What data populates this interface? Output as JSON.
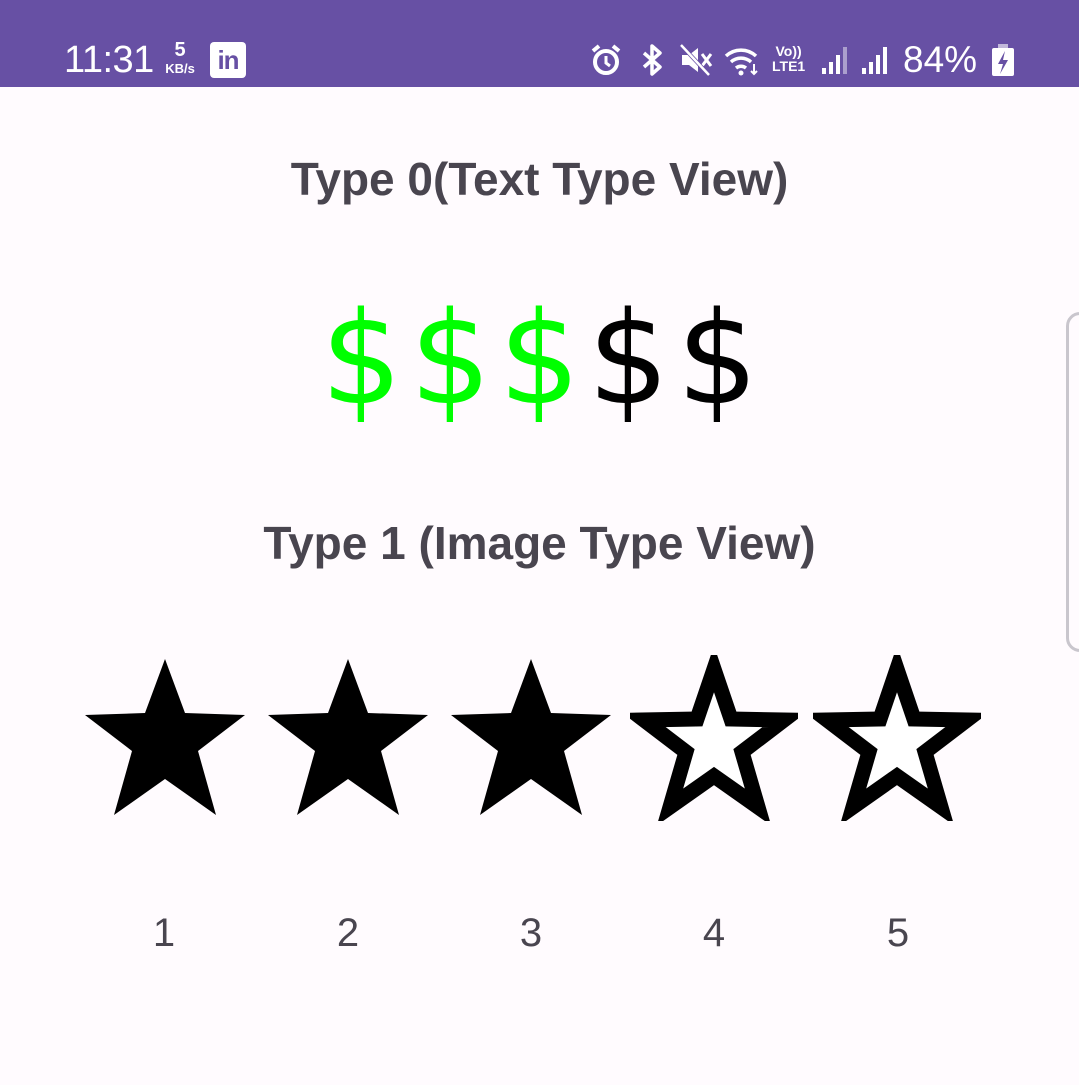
{
  "status_bar": {
    "time": "11:31",
    "net_speed_value": "5",
    "net_speed_unit": "KB/s",
    "linkedin_label": "in",
    "icons": [
      "alarm-icon",
      "bluetooth-icon",
      "mute-icon",
      "wifi-icon",
      "volte-icon",
      "signal-icon",
      "signal-icon",
      "battery-charging-icon"
    ],
    "lte_top": "Vo))",
    "lte_bottom": "LTE1",
    "battery_percent": "84%",
    "color": "#6750a4"
  },
  "type0": {
    "heading": "Type 0(Text Type View)",
    "symbol": "$",
    "rating": 3,
    "max": 5,
    "active_color": "#00ff00",
    "inactive_color": "#000000",
    "items": [
      "$",
      "$",
      "$",
      "$",
      "$"
    ]
  },
  "type1": {
    "heading": "Type 1 (Image Type View)",
    "rating": 3,
    "max": 5,
    "labels": [
      "1",
      "2",
      "3",
      "4",
      "5"
    ]
  }
}
